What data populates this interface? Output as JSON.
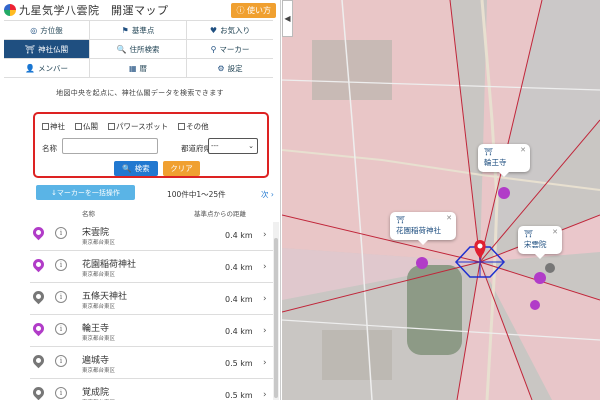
{
  "header": {
    "title": "九星気学八雲院　開運マップ",
    "howto_label": "使い方"
  },
  "nav": [
    {
      "label": "方位盤",
      "icon": "compass-icon",
      "glyph": "◎",
      "active": false
    },
    {
      "label": "基準点",
      "icon": "flag-icon",
      "glyph": "⚑",
      "active": false
    },
    {
      "label": "お気入り",
      "icon": "heart-icon",
      "glyph": "♥",
      "active": false
    },
    {
      "label": "神社仏閣",
      "icon": "shrine-icon",
      "glyph": "⛩",
      "active": true
    },
    {
      "label": "住所検索",
      "icon": "search-icon",
      "glyph": "🔍",
      "active": false
    },
    {
      "label": "マーカー",
      "icon": "marker-icon",
      "glyph": "⚲",
      "active": false
    },
    {
      "label": "メンバー",
      "icon": "user-icon",
      "glyph": "👤",
      "active": false
    },
    {
      "label": "暦",
      "icon": "calendar-icon",
      "glyph": "▦",
      "active": false
    },
    {
      "label": "設定",
      "icon": "gear-icon",
      "glyph": "⚙",
      "active": false
    }
  ],
  "search": {
    "description": "地図中央を起点に、神社仏閣データを検索できます",
    "checkboxes": [
      "神社",
      "仏閣",
      "パワースポット",
      "その他"
    ],
    "name_label": "名称",
    "name_value": "",
    "pref_label": "都道府県",
    "pref_value": "---",
    "search_label": "検索",
    "clear_label": "クリア"
  },
  "results": {
    "bulk_label": "↓マーカーを一括操作",
    "count_text": "100件中1～25件",
    "next_label": "次 ›",
    "col_name": "名称",
    "col_distance": "基準点からの距離",
    "rows": [
      {
        "name": "宋雲院",
        "address": "東京都台東区",
        "distance": "0.4 km",
        "color": "#b13cc8"
      },
      {
        "name": "花園稲荷神社",
        "address": "東京都台東区",
        "distance": "0.4 km",
        "color": "#b13cc8"
      },
      {
        "name": "五條天神社",
        "address": "東京都台東区",
        "distance": "0.4 km",
        "color": "#777777"
      },
      {
        "name": "輪王寺",
        "address": "東京都台東区",
        "distance": "0.4 km",
        "color": "#b13cc8"
      },
      {
        "name": "遍城寺",
        "address": "東京都台東区",
        "distance": "0.5 km",
        "color": "#777777"
      },
      {
        "name": "覚成院",
        "address": "東京都台東区",
        "distance": "0.5 km",
        "color": "#777777"
      }
    ]
  },
  "map": {
    "bubbles": [
      {
        "icon_text": "⛩",
        "label": "輪王寺"
      },
      {
        "icon_text": "⛩",
        "label": "花園稲荷神社"
      },
      {
        "icon_text": "⛩",
        "label": "宋雲院"
      }
    ],
    "collapse_label": "◀"
  }
}
